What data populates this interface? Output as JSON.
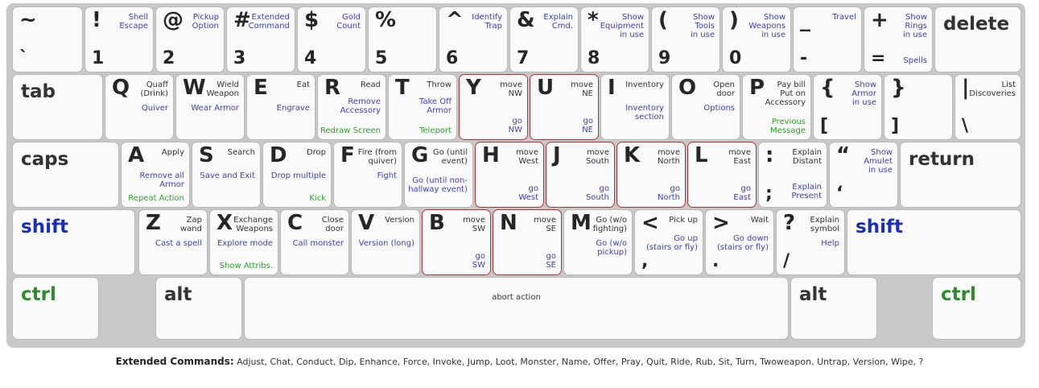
{
  "rows": {
    "r1": [
      {
        "id": "tilde",
        "top": "~",
        "bottom": "`"
      },
      {
        "id": "bang",
        "top": "!",
        "bottom": "1",
        "action": "Shell\nEscape"
      },
      {
        "id": "at",
        "top": "@",
        "bottom": "2",
        "action": "Pickup\nOption"
      },
      {
        "id": "hash",
        "top": "#",
        "bottom": "3",
        "action": "Extended\nCommand"
      },
      {
        "id": "dollar",
        "top": "$",
        "bottom": "4",
        "action": "Gold\nCount"
      },
      {
        "id": "percent",
        "top": "%",
        "bottom": "5"
      },
      {
        "id": "caret",
        "top": "^",
        "bottom": "6",
        "action": "Identify\nTrap"
      },
      {
        "id": "amp",
        "top": "&",
        "bottom": "7",
        "action": "Explain\nCmd."
      },
      {
        "id": "star",
        "top": "*",
        "bottom": "8",
        "action": "Show\nEquipment\nin use"
      },
      {
        "id": "lparen",
        "top": "(",
        "bottom": "9",
        "action": "Show\nTools\nin use"
      },
      {
        "id": "rparen",
        "top": ")",
        "bottom": "0",
        "action": "Show\nWeapons\nin use"
      },
      {
        "id": "underscore",
        "top": "_",
        "bottom": "-",
        "action": "Travel"
      },
      {
        "id": "plus",
        "top": "+",
        "bottom": "=",
        "action": "Show\nRings\nin use",
        "lower": "Spells"
      },
      {
        "id": "delete",
        "label": "delete"
      }
    ],
    "r2": [
      {
        "id": "tab",
        "label": "tab"
      },
      {
        "id": "Q",
        "letter": "Q",
        "action": "Quaff\n(Drink)",
        "lower": "Quiver"
      },
      {
        "id": "W",
        "letter": "W",
        "action": "Wield\nWeapon",
        "lower": "Wear Armor"
      },
      {
        "id": "E",
        "letter": "E",
        "action": "Eat",
        "lower": "Engrave"
      },
      {
        "id": "R",
        "letter": "R",
        "action": "Read",
        "lower": "Remove\nAccessory",
        "green": "Redraw Screen"
      },
      {
        "id": "T",
        "letter": "T",
        "action": "Throw",
        "lower": "Take Off\nArmor",
        "green": "Teleport"
      },
      {
        "id": "Y",
        "letter": "Y",
        "move": "move\nNW",
        "go": "go\nNW"
      },
      {
        "id": "U",
        "letter": "U",
        "move": "move\nNE",
        "go": "go\nNE"
      },
      {
        "id": "I",
        "letter": "I",
        "action": "Inventory",
        "lower": "Inventory\nsection"
      },
      {
        "id": "O",
        "letter": "O",
        "action": "Open\ndoor",
        "lower": "Options"
      },
      {
        "id": "P",
        "letter": "P",
        "action": "Pay bill\nPut on\nAccessory",
        "green": "Previous\nMessage"
      },
      {
        "id": "lbrace",
        "top": "{",
        "bottom": "[",
        "action": "Show\nArmor\nin use"
      },
      {
        "id": "rbrace",
        "top": "}",
        "bottom": "]"
      },
      {
        "id": "pipe",
        "top": "|",
        "bottom": "\\",
        "action": "List\nDiscoveries"
      }
    ],
    "r3": [
      {
        "id": "caps",
        "label": "caps"
      },
      {
        "id": "A",
        "letter": "A",
        "action": "Apply",
        "lower": "Remove all\nArmor",
        "green": "Repeat Action"
      },
      {
        "id": "S",
        "letter": "S",
        "action": "Search",
        "lower": "Save and Exit"
      },
      {
        "id": "D",
        "letter": "D",
        "action": "Drop",
        "lower": "Drop multiple",
        "green": "Kick"
      },
      {
        "id": "F",
        "letter": "F",
        "action": "Fire (from\nquiver)",
        "lower": "Fight"
      },
      {
        "id": "G",
        "letter": "G",
        "action": "Go (until\nevent)",
        "lower": "Go (until non-\nhallway event)"
      },
      {
        "id": "H",
        "letter": "H",
        "move": "move\nWest",
        "go": "go\nWest"
      },
      {
        "id": "J",
        "letter": "J",
        "move": "move\nSouth",
        "go": "go\nSouth"
      },
      {
        "id": "K",
        "letter": "K",
        "move": "move\nNorth",
        "go": "go\nNorth"
      },
      {
        "id": "L",
        "letter": "L",
        "move": "move\nEast",
        "go": "go\nEast"
      },
      {
        "id": "colon",
        "top": ":",
        "bottom": ";",
        "action": "Explain\nDistant",
        "lower": "Explain\nPresent"
      },
      {
        "id": "quote",
        "top": "“",
        "bottom": "‘",
        "action": "Show\nAmulet\nin use"
      },
      {
        "id": "return",
        "label": "return"
      }
    ],
    "r4": [
      {
        "id": "shiftL",
        "label": "shift"
      },
      {
        "id": "Z",
        "letter": "Z",
        "action": "Zap\nwand",
        "lower": "Cast a spell"
      },
      {
        "id": "X",
        "letter": "X",
        "action": "Exchange\nWeapons",
        "lower": "Explore mode",
        "green": "Show Attribs."
      },
      {
        "id": "C",
        "letter": "C",
        "action": "Close\ndoor",
        "lower": "Call monster"
      },
      {
        "id": "V",
        "letter": "V",
        "action": "Version",
        "lower": "Version (long)"
      },
      {
        "id": "B",
        "letter": "B",
        "move": "move\nSW",
        "go": "go\nSW"
      },
      {
        "id": "N",
        "letter": "N",
        "move": "move\nSE",
        "go": "go\nSE"
      },
      {
        "id": "M",
        "letter": "M",
        "action": "Go (w/o\nfighting)",
        "lower": "Go (w/o\npickup)"
      },
      {
        "id": "lt",
        "top": "<",
        "bottom": ",",
        "action": "Pick up",
        "lower": "Go up\n(stairs or fly)"
      },
      {
        "id": "gt",
        "top": ">",
        "bottom": ".",
        "action": "Wait",
        "lower": "Go down\n(stairs or fly)"
      },
      {
        "id": "question",
        "top": "?",
        "bottom": "/",
        "action": "Explain\nsymbol",
        "lower": "Help"
      },
      {
        "id": "shiftR",
        "label": "shift"
      }
    ],
    "r5": [
      {
        "id": "ctrlL",
        "label": "ctrl"
      },
      {
        "id": "altL",
        "label": "alt"
      },
      {
        "id": "space",
        "label": "abort action"
      },
      {
        "id": "altR",
        "label": "alt"
      },
      {
        "id": "ctrlR",
        "label": "ctrl"
      }
    ]
  },
  "extended": {
    "title": "Extended Commands:",
    "list": "Adjust, Chat, Conduct, Dip, Enhance, Force, Invoke, Jump, Loot, Monster, Name, Offer, Pray, Quit, Ride, Rub, Sit, Turn, Twoweapon, Untrap, Version, Wipe, ?"
  },
  "colors": {
    "action_blue": "#3f3fb0",
    "accent_green": "#2e9c2e",
    "move_border": "#b8322f",
    "shift_blue": "#1a2fb8",
    "ctrl_green": "#2e8b2e"
  }
}
